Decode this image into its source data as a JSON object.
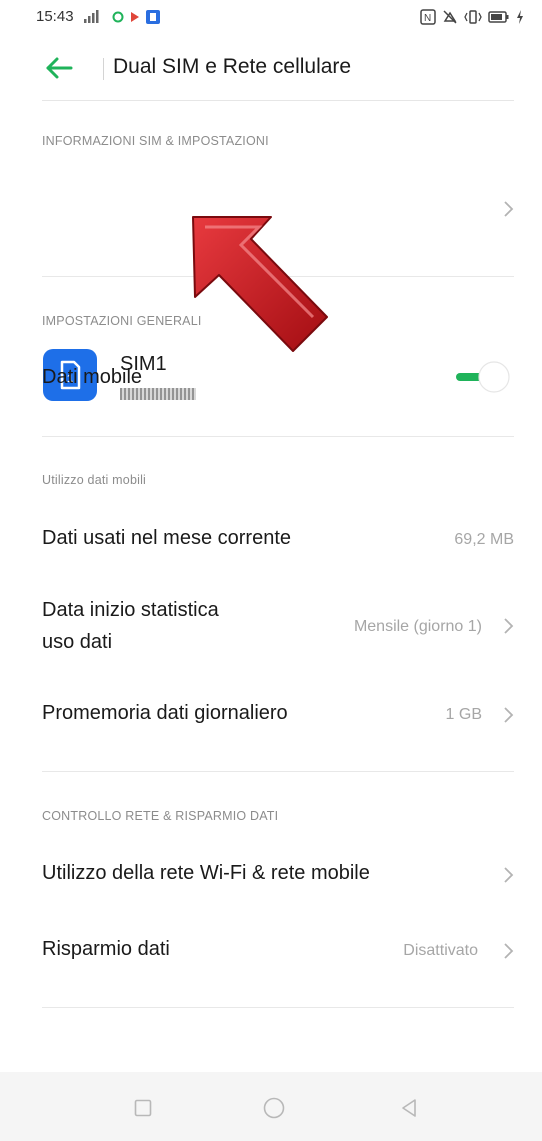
{
  "status_bar": {
    "time": "15:43"
  },
  "header": {
    "title": "Dual SIM e Rete cellulare"
  },
  "sections": {
    "sim_info_label": "INFORMAZIONI SIM & IMPOSTAZIONI",
    "general_label": "IMPOSTAZIONI GENERALI",
    "usage_label": "Utilizzo dati mobili",
    "network_label": "CONTROLLO RETE & RISPARMIO DATI"
  },
  "sim": {
    "name": "SIM1"
  },
  "rows": {
    "mobile_data": {
      "label": "Dati mobile",
      "enabled": true
    },
    "data_used": {
      "label": "Dati usati nel mese corrente",
      "value": "69,2 MB"
    },
    "stats_start": {
      "label_line1": "Data inizio statistica",
      "label_line2": "uso dati",
      "value": "Mensile (giorno 1)"
    },
    "daily_reminder": {
      "label": "Promemoria dati giornaliero",
      "value": "1 GB"
    },
    "wifi_mobile_usage": {
      "label": "Utilizzo della rete Wi-Fi & rete mobile"
    },
    "data_saver": {
      "label": "Risparmio dati",
      "value": "Disattivato"
    }
  },
  "colors": {
    "accent_green": "#1fb35a",
    "sim_blue": "#1e6fe8",
    "annotation_red": "#c8141a"
  },
  "icons": {
    "back": "back-arrow-icon",
    "sim": "sim-card-icon",
    "chevron": "chevron-right-icon",
    "nav_recent": "square-icon",
    "nav_home": "circle-icon",
    "nav_back": "triangle-back-icon"
  }
}
